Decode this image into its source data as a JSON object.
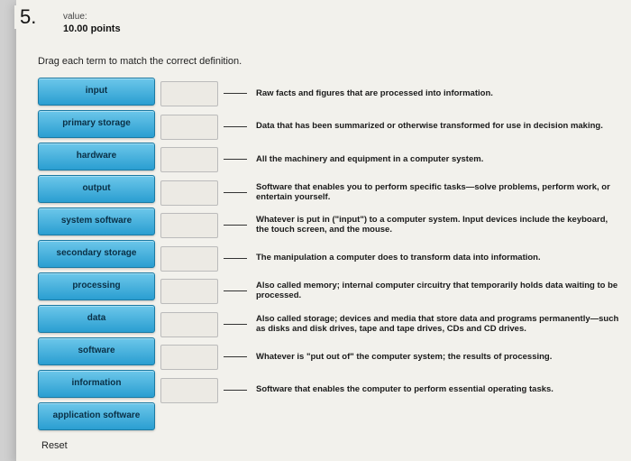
{
  "question_number": "5.",
  "value_label": "value:",
  "points": "10.00 points",
  "prompt": "Drag each term to match the correct definition.",
  "terms": [
    "input",
    "primary storage",
    "hardware",
    "output",
    "system software",
    "secondary storage",
    "processing",
    "data",
    "software",
    "information",
    "application software"
  ],
  "definitions": [
    "Raw facts and figures that are processed into information.",
    "Data that has been summarized or otherwise transformed for use in decision making.",
    "All the machinery and equipment in a computer system.",
    "Software that enables you to perform specific tasks—solve problems, perform work, or entertain yourself.",
    "Whatever is put in (\"input\") to a computer system. Input devices include the keyboard, the touch screen, and the mouse.",
    "The manipulation a computer does to transform data into information.",
    "Also called memory; internal computer circuitry that temporarily holds data waiting to be processed.",
    "Also called storage; devices and media that store data and programs permanently—such as disks and disk drives, tape and tape drives, CDs and CD drives.",
    "Whatever is \"put out of\" the computer system; the results of processing.",
    "Software that enables the computer to perform essential operating tasks."
  ],
  "reset": "Reset"
}
